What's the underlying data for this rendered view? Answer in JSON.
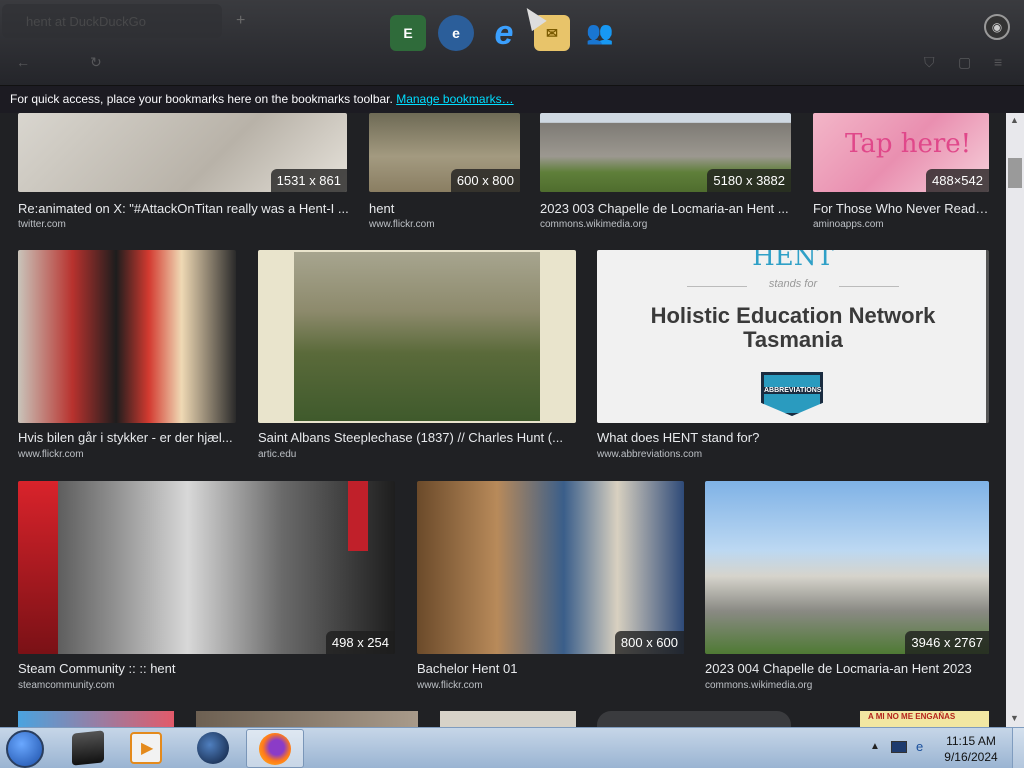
{
  "browser": {
    "tab_title": "hent at DuckDuckGo",
    "bookmarks_bar_text": "For quick access, place your bookmarks here on the bookmarks toolbar.",
    "manage_bookmarks_link": "Manage bookmarks…"
  },
  "dock": {
    "icons": [
      "app-icon-1",
      "ie-icon",
      "internet-explorer-icon",
      "mail-icon",
      "users-icon"
    ]
  },
  "results": [
    {
      "title": "Re:animated on X: \"#AttackOnTitan really was a Hent-I ...",
      "source": "twitter.com",
      "dimensions": "1531 x 861"
    },
    {
      "title": "hent",
      "source": "www.flickr.com",
      "dimensions": "600 x 800"
    },
    {
      "title": "2023 003 Chapelle de Locmaria-an Hent ...",
      "source": "commons.wikimedia.org",
      "dimensions": "5180 x 3882"
    },
    {
      "title": "For Those Who Never Read ...",
      "source": "aminoapps.com",
      "dimensions": "488×542",
      "overlay_text": "Tap here!"
    },
    {
      "title": "Hvis bilen går i stykker - er der hjæl...",
      "source": "www.flickr.com",
      "dimensions": ""
    },
    {
      "title": "Saint Albans Steeplechase (1837) // Charles Hunt (...",
      "source": "artic.edu",
      "dimensions": ""
    },
    {
      "title": "What does HENT stand for?",
      "source": "www.abbreviations.com",
      "dimensions": "",
      "image_heading": "HENT",
      "image_stands_for": "stands for",
      "image_text": "Holistic Education Network Tasmania",
      "image_badge": "ABBREVIATIONS"
    },
    {
      "title": "Steam Community :: :: hent",
      "source": "steamcommunity.com",
      "dimensions": "498 x 254"
    },
    {
      "title": "Bachelor Hent 01",
      "source": "www.flickr.com",
      "dimensions": "800 x 600"
    },
    {
      "title": "2023 004 Chapelle de Locmaria-an Hent 2023",
      "source": "commons.wikimedia.org",
      "dimensions": "3946 x 2767"
    }
  ],
  "partial_row": {
    "overlay_text": "A MI NO ME ENGAÑAS"
  },
  "taskbar": {
    "time": "11:15 AM",
    "date": "9/16/2024"
  }
}
